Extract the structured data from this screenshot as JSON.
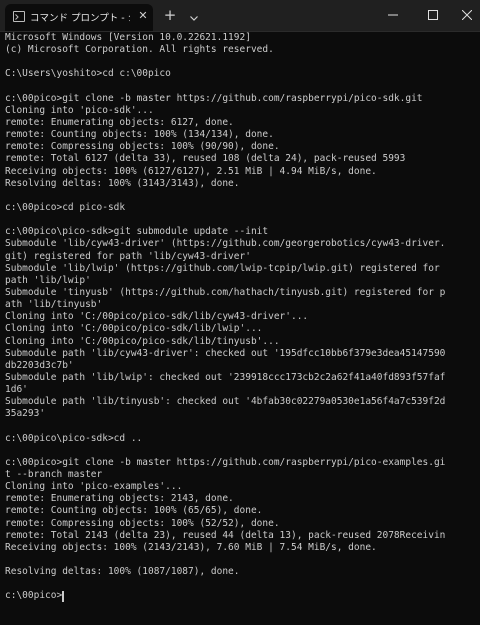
{
  "window": {
    "tab_title": "コマンド プロンプト - ショートカット",
    "tab_icon": "terminal-icon",
    "close_tab_glyph": "✕",
    "new_tab_glyph": "+",
    "dropdown_icon": "chevron-down-icon",
    "minimize_icon": "minimize-icon",
    "maximize_icon": "maximize-icon",
    "close_icon": "close-icon"
  },
  "colors": {
    "background": "#0c0c0c",
    "text": "#cccccc",
    "titlebar": "#202020"
  },
  "terminal": {
    "lines": [
      "Microsoft Windows [Version 10.0.22621.1192]",
      "(c) Microsoft Corporation. All rights reserved.",
      "",
      "C:\\Users\\yoshito>cd c:\\00pico",
      "",
      "c:\\00pico>git clone -b master https://github.com/raspberrypi/pico-sdk.git",
      "Cloning into 'pico-sdk'...",
      "remote: Enumerating objects: 6127, done.",
      "remote: Counting objects: 100% (134/134), done.",
      "remote: Compressing objects: 100% (90/90), done.",
      "remote: Total 6127 (delta 33), reused 108 (delta 24), pack-reused 5993",
      "Receiving objects: 100% (6127/6127), 2.51 MiB | 4.94 MiB/s, done.",
      "Resolving deltas: 100% (3143/3143), done.",
      "",
      "c:\\00pico>cd pico-sdk",
      "",
      "c:\\00pico\\pico-sdk>git submodule update --init",
      "Submodule 'lib/cyw43-driver' (https://github.com/georgerobotics/cyw43-driver.",
      "git) registered for path 'lib/cyw43-driver'",
      "Submodule 'lib/lwip' (https://github.com/lwip-tcpip/lwip.git) registered for",
      "path 'lib/lwip'",
      "Submodule 'tinyusb' (https://github.com/hathach/tinyusb.git) registered for p",
      "ath 'lib/tinyusb'",
      "Cloning into 'C:/00pico/pico-sdk/lib/cyw43-driver'...",
      "Cloning into 'C:/00pico/pico-sdk/lib/lwip'...",
      "Cloning into 'C:/00pico/pico-sdk/lib/tinyusb'...",
      "Submodule path 'lib/cyw43-driver': checked out '195dfcc10bb6f379e3dea45147590",
      "db2203d3c7b'",
      "Submodule path 'lib/lwip': checked out '239918ccc173cb2c2a62f41a40fd893f57faf",
      "1d6'",
      "Submodule path 'lib/tinyusb': checked out '4bfab30c02279a0530e1a56f4a7c539f2d",
      "35a293'",
      "",
      "c:\\00pico\\pico-sdk>cd ..",
      "",
      "c:\\00pico>git clone -b master https://github.com/raspberrypi/pico-examples.gi",
      "t --branch master",
      "Cloning into 'pico-examples'...",
      "remote: Enumerating objects: 2143, done.",
      "remote: Counting objects: 100% (65/65), done.",
      "remote: Compressing objects: 100% (52/52), done.",
      "remote: Total 2143 (delta 23), reused 44 (delta 13), pack-reused 2078Receivin",
      "Receiving objects: 100% (2143/2143), 7.60 MiB | 7.54 MiB/s, done.",
      "",
      "Resolving deltas: 100% (1087/1087), done.",
      "",
      "c:\\00pico>"
    ]
  }
}
